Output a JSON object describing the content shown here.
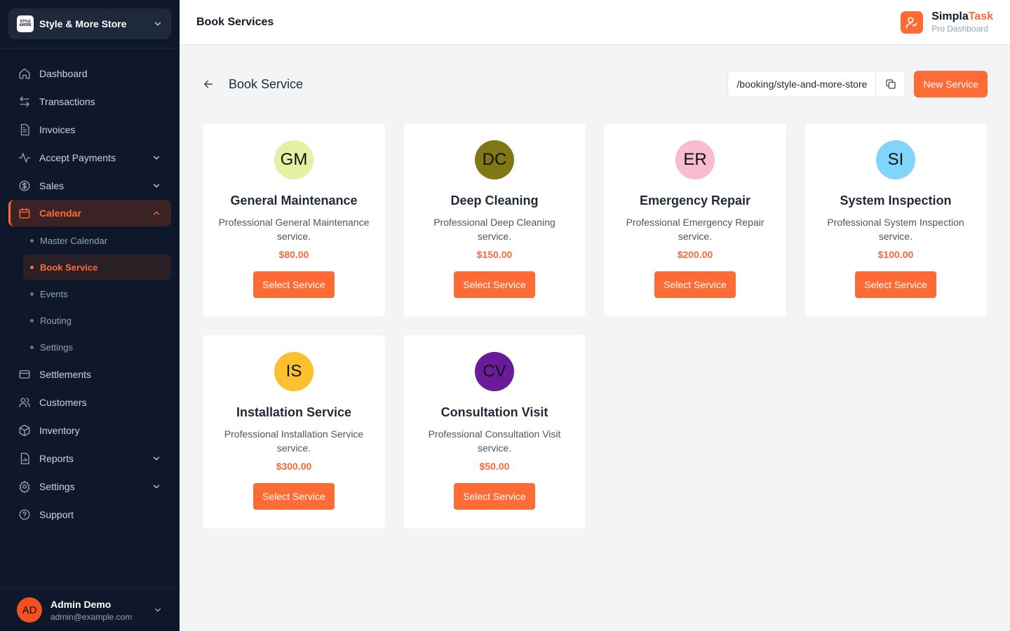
{
  "store": {
    "name": "Style & More Store",
    "logo_text": [
      "STYLE",
      "&MORE"
    ]
  },
  "nav": {
    "dashboard": "Dashboard",
    "transactions": "Transactions",
    "invoices": "Invoices",
    "accept_payments": "Accept Payments",
    "sales": "Sales",
    "calendar": "Calendar",
    "calendar_sub": {
      "master_calendar": "Master Calendar",
      "book_service": "Book Service",
      "events": "Events",
      "routing": "Routing",
      "settings": "Settings"
    },
    "settlements": "Settlements",
    "customers": "Customers",
    "inventory": "Inventory",
    "reports": "Reports",
    "settings": "Settings",
    "support": "Support"
  },
  "user": {
    "initials": "AD",
    "name": "Admin Demo",
    "email": "admin@example.com"
  },
  "header": {
    "title": "Book Services",
    "brand_name_a": "Simpla",
    "brand_name_b": "Task",
    "brand_sub": "Pro Dashboard"
  },
  "page": {
    "title": "Book Service",
    "booking_url": "/booking/style-and-more-store",
    "new_service_label": "New Service"
  },
  "colors": {
    "accent": "#ff6b35",
    "sidebar_bg": "#0f172a"
  },
  "services": [
    {
      "initials": "GM",
      "name": "General Maintenance",
      "description": "Professional General Maintenance service.",
      "price": "$80.00",
      "button": "Select Service",
      "color": "#e6f0a3"
    },
    {
      "initials": "DC",
      "name": "Deep Cleaning",
      "description": "Professional Deep Cleaning service.",
      "price": "$150.00",
      "button": "Select Service",
      "color": "#827717"
    },
    {
      "initials": "ER",
      "name": "Emergency Repair",
      "description": "Professional Emergency Repair service.",
      "price": "$200.00",
      "button": "Select Service",
      "color": "#f8bbd0"
    },
    {
      "initials": "SI",
      "name": "System Inspection",
      "description": "Professional System Inspection service.",
      "price": "$100.00",
      "button": "Select Service",
      "color": "#81d4fa"
    },
    {
      "initials": "IS",
      "name": "Installation Service",
      "description": "Professional Installation Service service.",
      "price": "$300.00",
      "button": "Select Service",
      "color": "#fbc02d"
    },
    {
      "initials": "CV",
      "name": "Consultation Visit",
      "description": "Professional Consultation Visit service.",
      "price": "$50.00",
      "button": "Select Service",
      "color": "#6a1b9a"
    }
  ]
}
